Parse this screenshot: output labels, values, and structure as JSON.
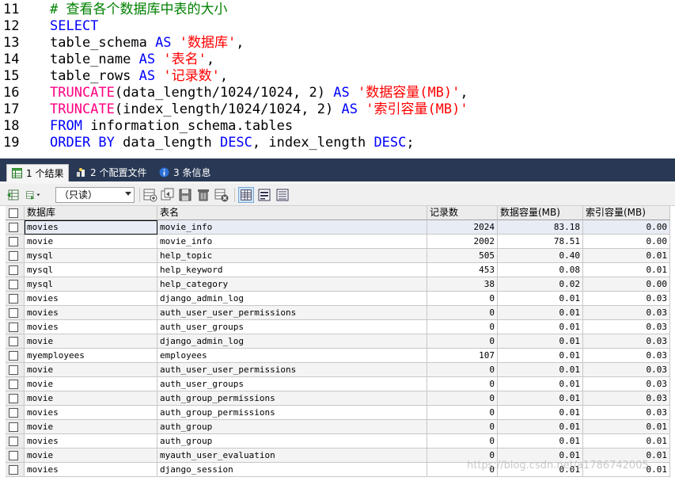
{
  "editor": {
    "lines": [
      {
        "num": "11",
        "tokens": [
          {
            "t": "# 查看各个数据库中表的大小",
            "c": "cm"
          }
        ]
      },
      {
        "num": "12",
        "tokens": [
          {
            "t": "SELECT",
            "c": "kw"
          }
        ]
      },
      {
        "num": "13",
        "tokens": [
          {
            "t": "table_schema ",
            "c": ""
          },
          {
            "t": "AS",
            "c": "kw"
          },
          {
            "t": " ",
            "c": ""
          },
          {
            "t": "'数据库'",
            "c": "str"
          },
          {
            "t": ",",
            "c": ""
          }
        ]
      },
      {
        "num": "14",
        "tokens": [
          {
            "t": "table_name ",
            "c": ""
          },
          {
            "t": "AS",
            "c": "kw"
          },
          {
            "t": " ",
            "c": ""
          },
          {
            "t": "'表名'",
            "c": "str"
          },
          {
            "t": ",",
            "c": ""
          }
        ]
      },
      {
        "num": "15",
        "tokens": [
          {
            "t": "table_rows ",
            "c": ""
          },
          {
            "t": "AS",
            "c": "kw"
          },
          {
            "t": " ",
            "c": ""
          },
          {
            "t": "'记录数'",
            "c": "str"
          },
          {
            "t": ",",
            "c": ""
          }
        ]
      },
      {
        "num": "16",
        "tokens": [
          {
            "t": "TRUNCATE",
            "c": "fn"
          },
          {
            "t": "(data_length/1024/1024, 2) ",
            "c": ""
          },
          {
            "t": "AS",
            "c": "kw"
          },
          {
            "t": " ",
            "c": ""
          },
          {
            "t": "'数据容量(MB)'",
            "c": "str"
          },
          {
            "t": ",",
            "c": ""
          }
        ]
      },
      {
        "num": "17",
        "tokens": [
          {
            "t": "TRUNCATE",
            "c": "fn"
          },
          {
            "t": "(index_length/1024/1024, 2) ",
            "c": ""
          },
          {
            "t": "AS",
            "c": "kw"
          },
          {
            "t": " ",
            "c": ""
          },
          {
            "t": "'索引容量(MB)'",
            "c": "str"
          }
        ]
      },
      {
        "num": "18",
        "tokens": [
          {
            "t": "FROM",
            "c": "kw"
          },
          {
            "t": " information_schema.tables",
            "c": ""
          }
        ]
      },
      {
        "num": "19",
        "tokens": [
          {
            "t": "ORDER BY",
            "c": "kw"
          },
          {
            "t": " data_length ",
            "c": ""
          },
          {
            "t": "DESC",
            "c": "kw"
          },
          {
            "t": ", index_length ",
            "c": ""
          },
          {
            "t": "DESC",
            "c": "kw"
          },
          {
            "t": ";",
            "c": ""
          }
        ]
      }
    ]
  },
  "tabs": [
    {
      "label": "1 个结果",
      "icon": "table-icon"
    },
    {
      "label": "2 个配置文件",
      "icon": "profile-icon"
    },
    {
      "label": "3 条信息",
      "icon": "info-icon"
    }
  ],
  "toolbar": {
    "mode_select_value": "（只读）"
  },
  "grid": {
    "columns": [
      "数据库",
      "表名",
      "记录数",
      "数据容量(MB)",
      "索引容量(MB)"
    ],
    "rows": [
      [
        "movies",
        "movie_info",
        "2024",
        "83.18",
        "0.00"
      ],
      [
        "movie",
        "movie_info",
        "2002",
        "78.51",
        "0.00"
      ],
      [
        "mysql",
        "help_topic",
        "505",
        "0.40",
        "0.01"
      ],
      [
        "mysql",
        "help_keyword",
        "453",
        "0.08",
        "0.01"
      ],
      [
        "mysql",
        "help_category",
        "38",
        "0.02",
        "0.00"
      ],
      [
        "movies",
        "django_admin_log",
        "0",
        "0.01",
        "0.03"
      ],
      [
        "movies",
        "auth_user_user_permissions",
        "0",
        "0.01",
        "0.03"
      ],
      [
        "movies",
        "auth_user_groups",
        "0",
        "0.01",
        "0.03"
      ],
      [
        "movie",
        "django_admin_log",
        "0",
        "0.01",
        "0.03"
      ],
      [
        "myemployees",
        "employees",
        "107",
        "0.01",
        "0.03"
      ],
      [
        "movie",
        "auth_user_user_permissions",
        "0",
        "0.01",
        "0.03"
      ],
      [
        "movie",
        "auth_user_groups",
        "0",
        "0.01",
        "0.03"
      ],
      [
        "movie",
        "auth_group_permissions",
        "0",
        "0.01",
        "0.03"
      ],
      [
        "movies",
        "auth_group_permissions",
        "0",
        "0.01",
        "0.03"
      ],
      [
        "movie",
        "auth_group",
        "0",
        "0.01",
        "0.01"
      ],
      [
        "movies",
        "auth_group",
        "0",
        "0.01",
        "0.01"
      ],
      [
        "movie",
        "myauth_user_evaluation",
        "0",
        "0.01",
        "0.01"
      ],
      [
        "movies",
        "django_session",
        "0",
        "0.01",
        "0.01"
      ]
    ]
  },
  "watermark": "https://blog.csdn.net/a1786742005"
}
